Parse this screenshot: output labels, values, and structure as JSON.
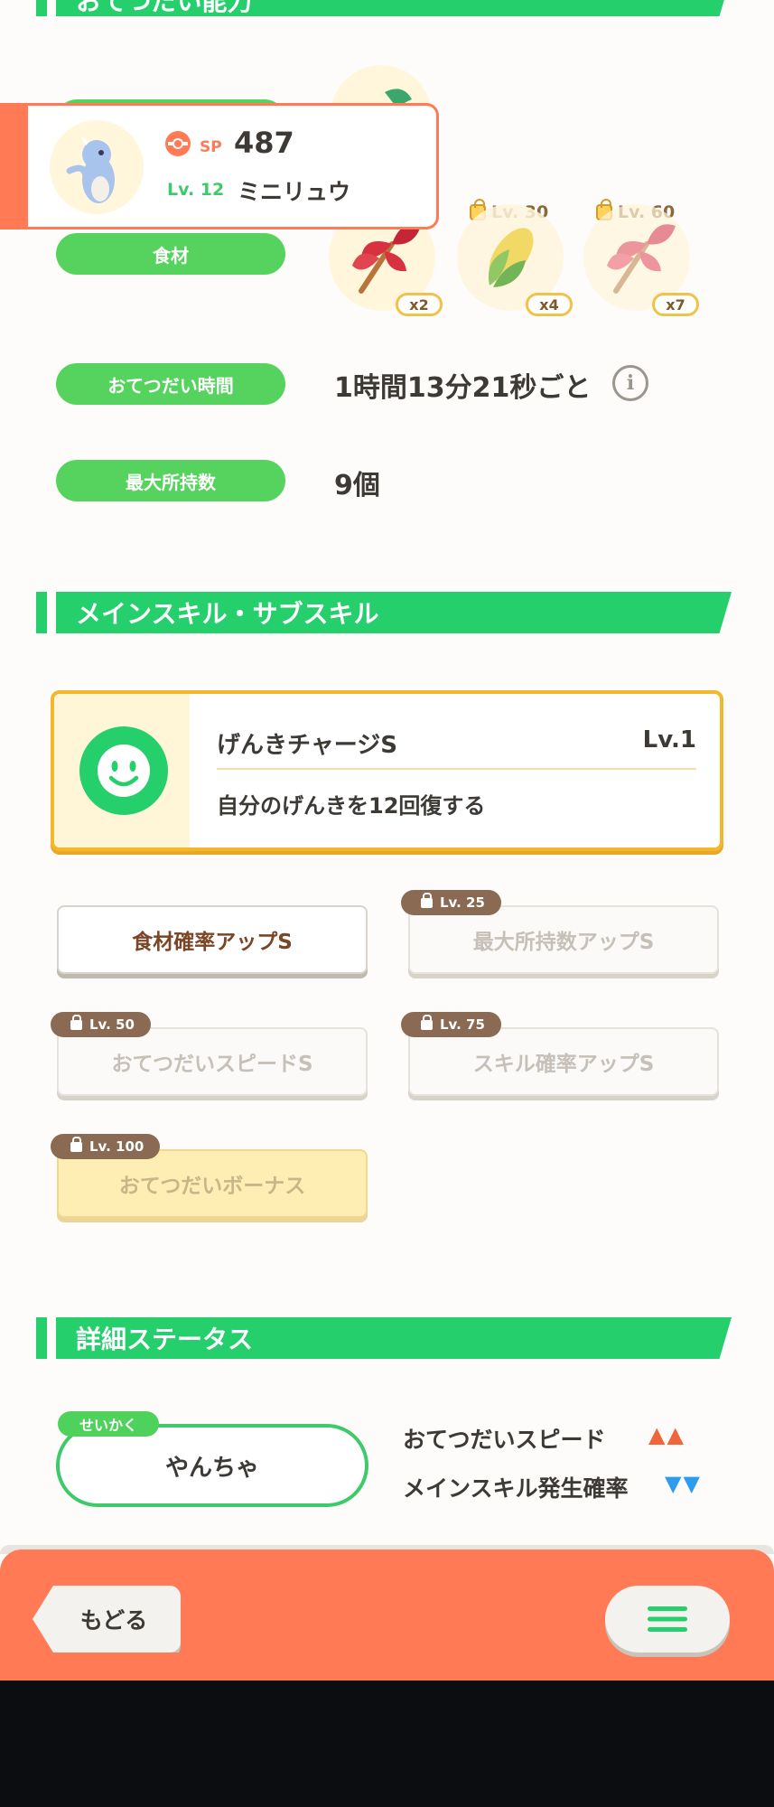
{
  "sections": {
    "top_partial_title": "おてつだい能力",
    "main_sub_skill_title": "メインスキル・サブスキル",
    "detail_status_title": "詳細ステータス"
  },
  "pokemon_card": {
    "sp_label": "SP",
    "sp_value": "487",
    "level": "Lv. 12",
    "name": "ミニリュウ"
  },
  "helper_ability": {
    "ingredient_label": "食材",
    "ingredients": [
      {
        "icon": "red-herb-icon",
        "qty": "x2",
        "unlock_level": ""
      },
      {
        "icon": "corn-icon",
        "qty": "x4",
        "unlock_level": "Lv. 30"
      },
      {
        "icon": "red-herb-icon",
        "qty": "x7",
        "unlock_level": "Lv. 60"
      }
    ],
    "help_time_label": "おてつだい時間",
    "help_time_value": "1時間13分21秒ごと",
    "max_carry_label": "最大所持数",
    "max_carry_value": "9個"
  },
  "main_skill": {
    "name": "げんきチャージS",
    "level": "Lv.1",
    "description": "自分のげんきを12回復する"
  },
  "sub_skills": [
    {
      "label": "食材確率アップS",
      "unlock_level": "",
      "state": "active"
    },
    {
      "label": "最大所持数アップS",
      "unlock_level": "Lv. 25",
      "state": "locked"
    },
    {
      "label": "おてつだいスピードS",
      "unlock_level": "Lv. 50",
      "state": "locked"
    },
    {
      "label": "スキル確率アップS",
      "unlock_level": "Lv. 75",
      "state": "locked"
    },
    {
      "label": "おてつだいボーナス",
      "unlock_level": "Lv. 100",
      "state": "locked-gold"
    }
  ],
  "nature": {
    "tag": "せいかく",
    "value": "やんちゃ",
    "up_stat": "おてつだいスピード",
    "up_arrows": "▲▲",
    "down_stat": "メインスキル発生確率",
    "down_arrows": "▼▼"
  },
  "footer": {
    "back_label": "もどる",
    "menu_icon": "hamburger-menu-icon"
  },
  "colors": {
    "accent_green": "#25cf6c",
    "footer_orange": "#ff7a55",
    "up_arrow": "#f0653a",
    "down_arrow": "#2d9cf0",
    "skill_gold": "#f4b62a"
  }
}
